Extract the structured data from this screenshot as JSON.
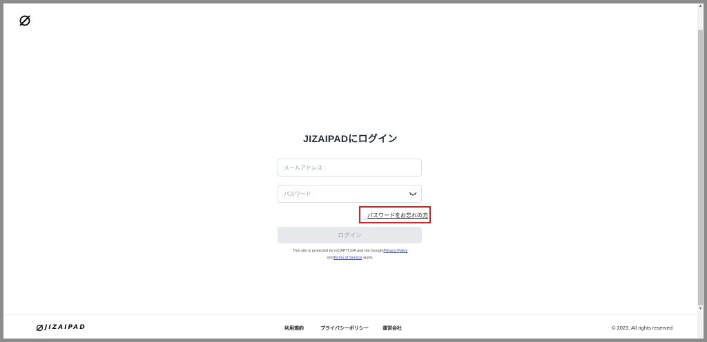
{
  "header": {
    "logo_icon": "jizaipad-mark-icon"
  },
  "login": {
    "title": "JIZAIPADにログイン",
    "email_placeholder": "メールアドレス",
    "password_placeholder": "パスワード",
    "forgot_password": "パスワードをお忘れの方",
    "login_button": "ログイン",
    "highlight_color": "#e21b1b"
  },
  "recaptcha": {
    "prefix": "This site is protected by reCAPTCHA and the Google",
    "privacy_link": "Privacy Policy",
    "and": "and",
    "terms_link": "Terms of Service",
    "suffix": " apply."
  },
  "footer": {
    "logo_text": "JIZAIPAD",
    "links": [
      "利用規約",
      "プライバシーポリシー",
      "運営会社"
    ],
    "copyright": "© 2023. All rights reserved"
  }
}
